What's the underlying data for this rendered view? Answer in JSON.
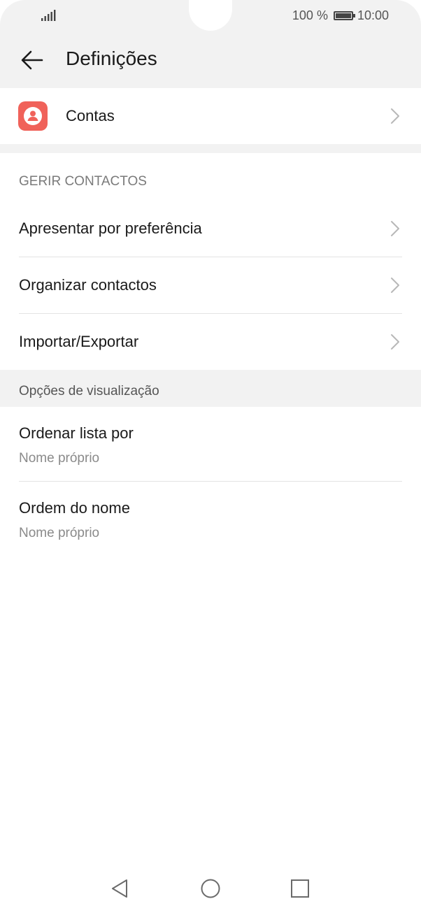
{
  "status_bar": {
    "battery_text": "100 %",
    "time": "10:00"
  },
  "header": {
    "title": "Definições"
  },
  "accounts": {
    "label": "Contas"
  },
  "manage_section": {
    "heading": "GERIR CONTACTOS",
    "items": [
      {
        "label": "Apresentar por preferência"
      },
      {
        "label": "Organizar contactos"
      },
      {
        "label": "Importar/Exportar"
      }
    ]
  },
  "display_section": {
    "heading": "Opções de visualização",
    "items": [
      {
        "label": "Ordenar lista por",
        "value": "Nome próprio"
      },
      {
        "label": "Ordem do nome",
        "value": "Nome próprio"
      }
    ]
  },
  "colors": {
    "accent": "#f0625a",
    "header_bg": "#f2f2f2"
  },
  "icons": {
    "back": "back-arrow-icon",
    "accounts": "account-icon",
    "chevron": "chevron-right-icon",
    "nav_back": "nav-back-icon",
    "nav_home": "nav-home-icon",
    "nav_recents": "nav-recents-icon"
  }
}
